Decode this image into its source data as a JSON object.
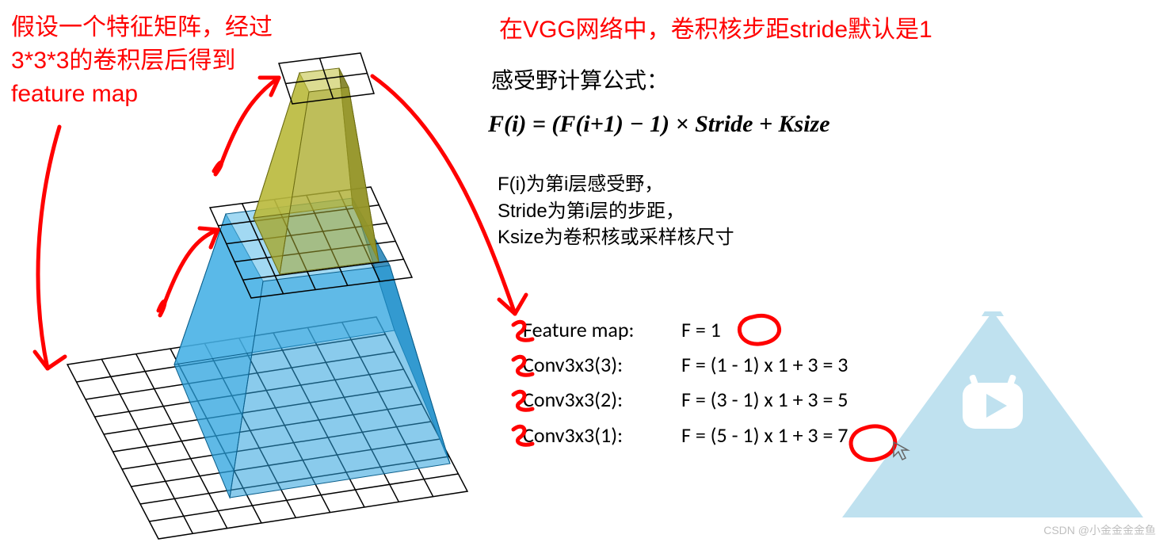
{
  "left_caption": {
    "line1": "假设一个特征矩阵，经过",
    "line2": "3*3*3的卷积层后得到",
    "line3": "feature map"
  },
  "right_heading": "在VGG网络中，卷积核步距stride默认是1",
  "formula_title": "感受野计算公式：",
  "formula": "F(i) = (F(i+1) − 1) × Stride + Ksize",
  "formula_desc": {
    "l1": "F(i)为第i层感受野，",
    "l2": "Stride为第i层的步距，",
    "l3": "Ksize为卷积核或采样核尺寸"
  },
  "calc": [
    {
      "label": "Feature map:",
      "value": "F = 1"
    },
    {
      "label": "Conv3x3(3):",
      "value": "F = (1 - 1) x 1 + 3 = 3"
    },
    {
      "label": "Conv3x3(2):",
      "value": "F = (3 - 1) x 1 + 3 = 5"
    },
    {
      "label": "Conv3x3(1):",
      "value": "F = (5 - 1) x 1 + 3 = 7"
    }
  ],
  "watermark": "CSDN @小金金金金鱼",
  "colors": {
    "red": "#ff0000",
    "blue_frustum": "#2aa1dd",
    "blue_frustum_dark": "#1d7fb5",
    "olive": "#a6a62c",
    "olive_dark": "#7e7e20",
    "triangle": "#bfe1ef",
    "grid": "#000000"
  }
}
